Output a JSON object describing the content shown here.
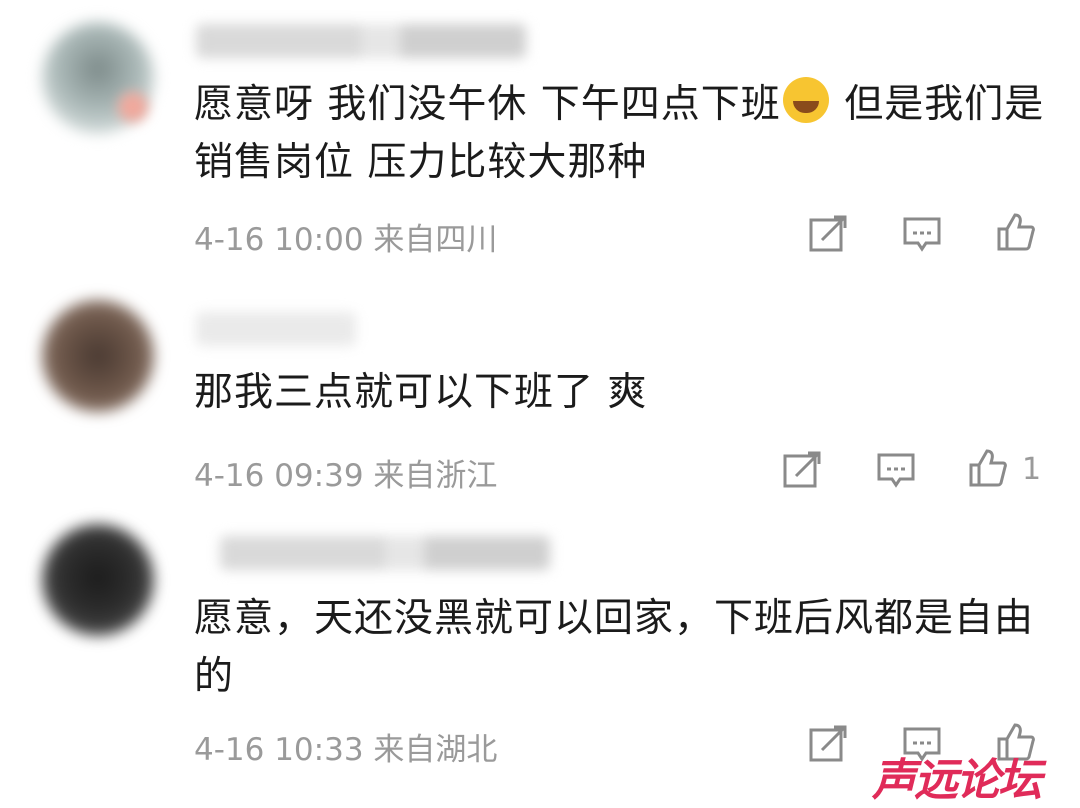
{
  "comments": [
    {
      "text_a": "愿意呀  我们没午休  下午四点下班",
      "emoji": "crying-laughing-emoji",
      "text_b": " 但是我们是销售岗位  压力比较大那种",
      "meta": "4-16 10:00  来自四川",
      "likes": ""
    },
    {
      "text_a": "那我三点就可以下班了 爽",
      "meta": "4-16 09:39  来自浙江",
      "likes": "1"
    },
    {
      "text_a": "愿意，天还没黑就可以回家，下班后风都是自由的",
      "meta": "4-16 10:33  来自湖北",
      "likes": ""
    }
  ],
  "watermark": "声远论坛",
  "colors": {
    "text": "#1b1b1b",
    "meta": "#9a9a9a",
    "watermark": "#e02b59"
  }
}
